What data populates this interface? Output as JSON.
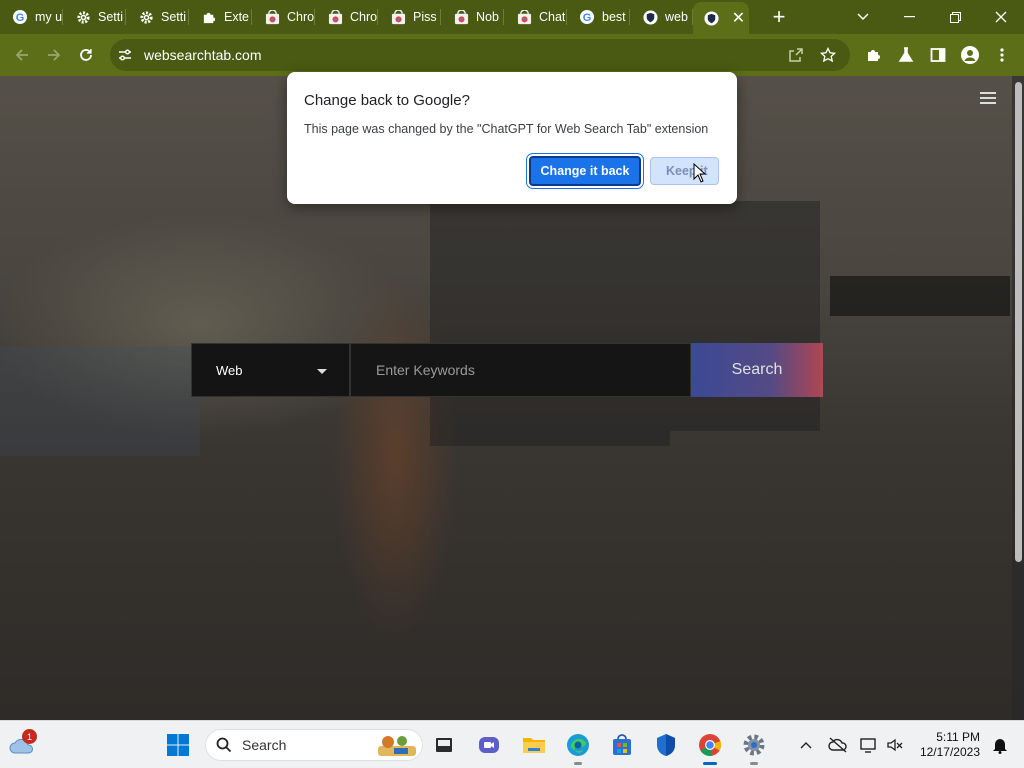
{
  "browser": {
    "tabs": [
      {
        "label": "my u",
        "icon": "google-icon"
      },
      {
        "label": "Setti",
        "icon": "gear-icon"
      },
      {
        "label": "Setti",
        "icon": "gear-icon"
      },
      {
        "label": "Exte",
        "icon": "puzzle-icon"
      },
      {
        "label": "Chro",
        "icon": "chrome-store-icon"
      },
      {
        "label": "Chro",
        "icon": "chrome-store-icon"
      },
      {
        "label": "Piss",
        "icon": "chrome-store-icon"
      },
      {
        "label": "Nob",
        "icon": "chrome-store-icon"
      },
      {
        "label": "Chat",
        "icon": "chrome-store-icon"
      },
      {
        "label": "best",
        "icon": "google-icon"
      },
      {
        "label": "web",
        "icon": "shield-icon"
      }
    ],
    "active_tab_icon": "shield-icon",
    "url": "websearchtab.com",
    "accent": "#5d6e19"
  },
  "page": {
    "search_type": "Web",
    "search_placeholder": "Enter Keywords",
    "search_button": "Search"
  },
  "dialog": {
    "title": "Change back to Google?",
    "message": "This page was changed by the \"ChatGPT for Web Search Tab\" extension",
    "primary_button": "Change it back",
    "secondary_button": "Keep it"
  },
  "taskbar": {
    "search_label": "Search",
    "weather_badge": "1",
    "time": "5:11 PM",
    "date": "12/17/2023"
  }
}
